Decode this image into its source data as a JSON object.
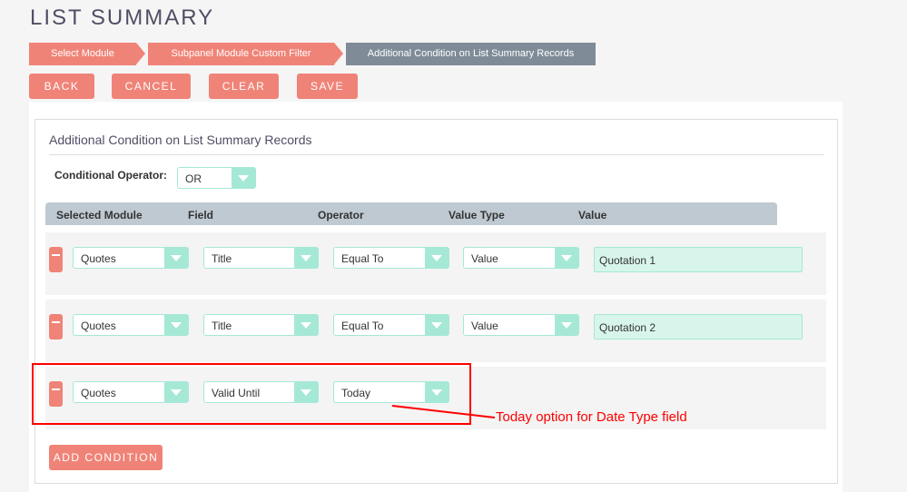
{
  "title": "LIST SUMMARY",
  "breadcrumbs": [
    "Select Module",
    "Subpanel Module Custom Filter",
    "Additional Condition on List Summary Records"
  ],
  "buttons": {
    "back": "BACK",
    "cancel": "CANCEL",
    "clear": "CLEAR",
    "save": "SAVE",
    "add_condition": "ADD CONDITION"
  },
  "section_title": "Additional Condition on List Summary Records",
  "conditional_operator": {
    "label": "Conditional Operator:",
    "value": "OR"
  },
  "columns": [
    "Selected Module",
    "Field",
    "Operator",
    "Value Type",
    "Value"
  ],
  "rows": [
    {
      "module": "Quotes",
      "field": "Title",
      "operator": "Equal To",
      "value_type": "Value",
      "value": "Quotation 1"
    },
    {
      "module": "Quotes",
      "field": "Title",
      "operator": "Equal To",
      "value_type": "Value",
      "value": "Quotation 2"
    },
    {
      "module": "Quotes",
      "field": "Valid Until",
      "operator": "Today"
    }
  ],
  "annotation": "Today option for Date Type field",
  "colors": {
    "accent": "#f08377",
    "select": "#a5e8d6",
    "annotation": "#ff0000"
  }
}
